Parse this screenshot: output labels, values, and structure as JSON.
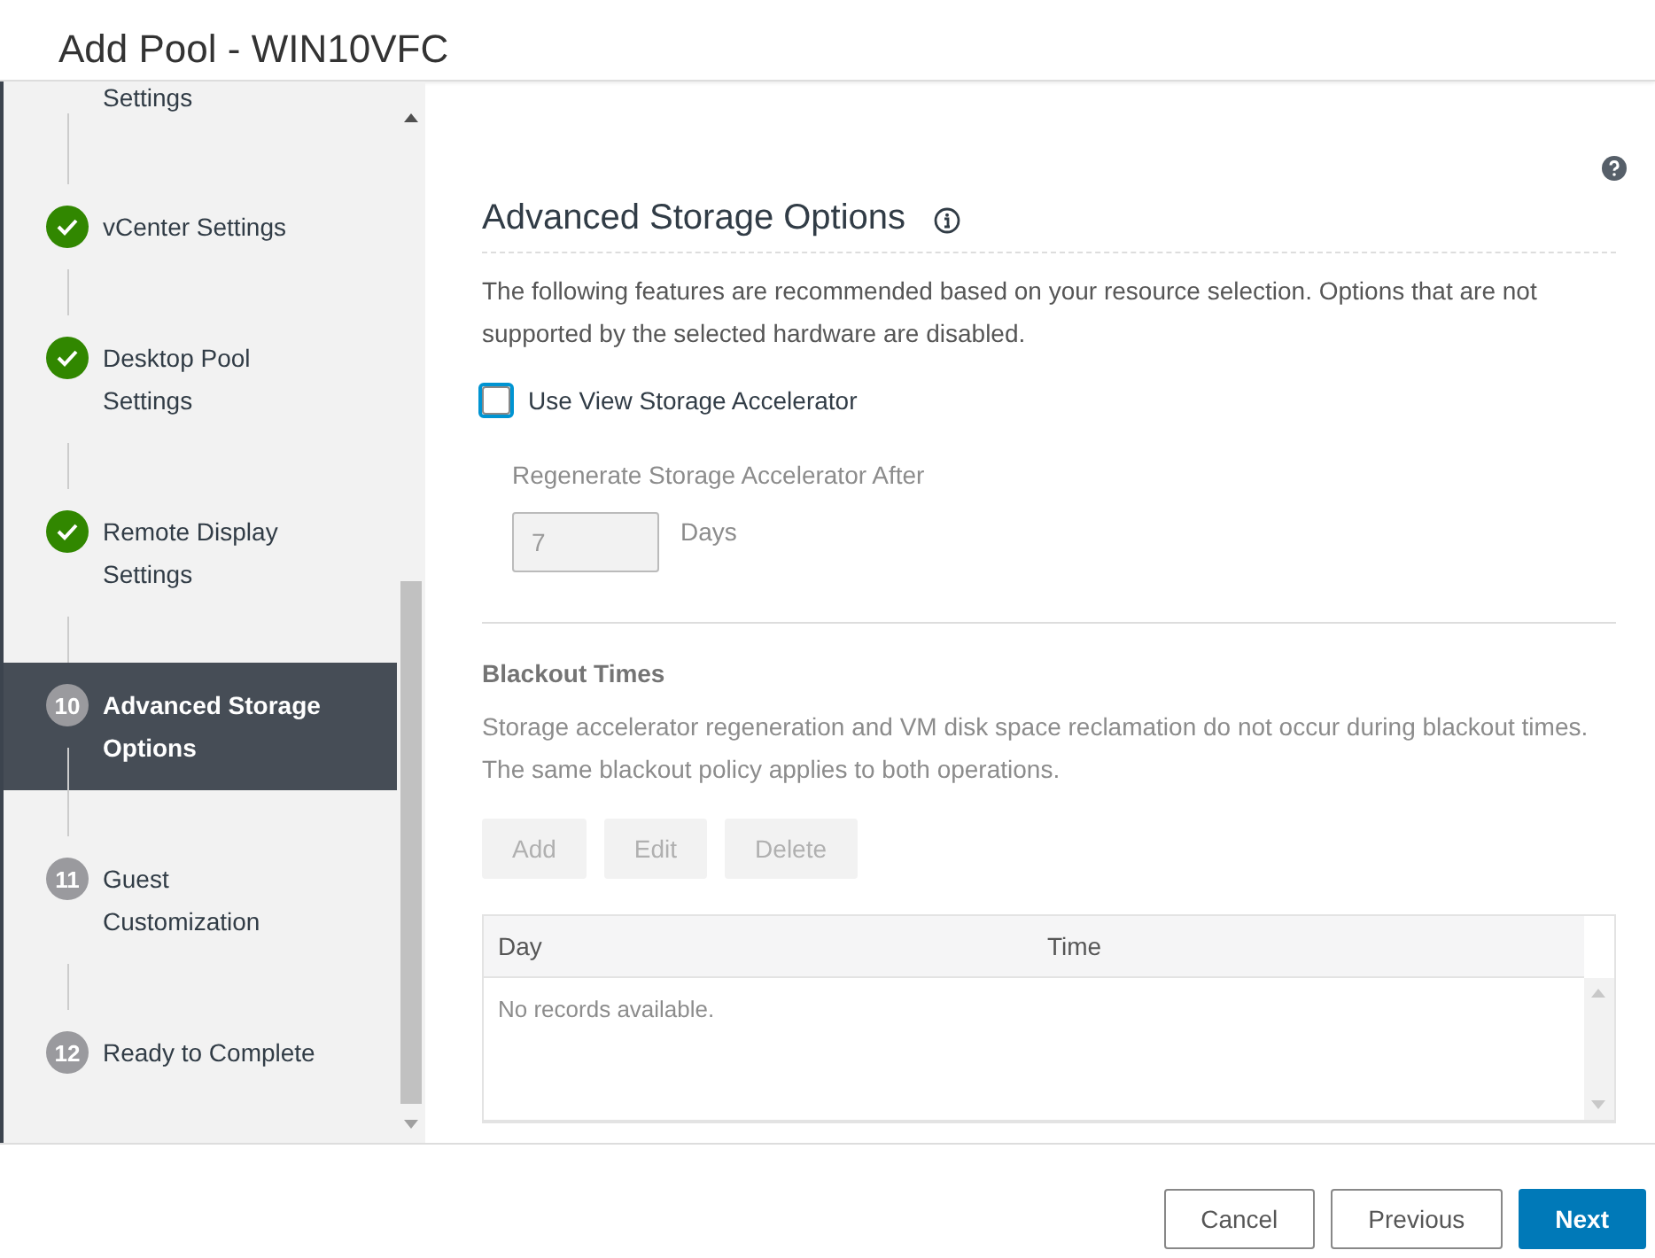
{
  "window": {
    "title": "Add Pool - WIN10VFC"
  },
  "partial_step": {
    "label": "Settings"
  },
  "steps": [
    {
      "label": "vCenter Settings",
      "kind": "done",
      "selected": false
    },
    {
      "label": "Desktop Pool Settings",
      "kind": "done",
      "selected": false
    },
    {
      "label": "Remote Display Settings",
      "kind": "done",
      "selected": false
    },
    {
      "number": "10",
      "label": "Advanced Storage Options",
      "kind": "numbered",
      "selected": true
    },
    {
      "number": "11",
      "label": "Guest Customization",
      "kind": "numbered",
      "selected": false
    },
    {
      "number": "12",
      "label": "Ready to Complete",
      "kind": "numbered",
      "selected": false
    }
  ],
  "content": {
    "title": "Advanced Storage Options",
    "intro": "The following features are recommended based on your resource selection. Options that are not supported by the selected hardware are disabled.",
    "accelerator": {
      "label": "Use View Storage Accelerator",
      "checked": false,
      "focused": true
    },
    "regenerate": {
      "label": "Regenerate Storage Accelerator After",
      "value": "7",
      "unit": "Days",
      "disabled": true
    },
    "blackout": {
      "title": "Blackout Times",
      "description": "Storage accelerator regeneration and VM disk space reclamation do not occur during blackout times. The same blackout policy applies to both operations.",
      "buttons": [
        {
          "label": "Add",
          "disabled": true
        },
        {
          "label": "Edit",
          "disabled": true
        },
        {
          "label": "Delete",
          "disabled": true
        }
      ],
      "table": {
        "columns": [
          "Day",
          "Time"
        ],
        "empty_message": "No records available."
      }
    }
  },
  "footer": {
    "buttons": [
      {
        "label": "Cancel",
        "kind": "secondary"
      },
      {
        "label": "Previous",
        "kind": "secondary"
      },
      {
        "label": "Next",
        "kind": "primary"
      }
    ]
  }
}
